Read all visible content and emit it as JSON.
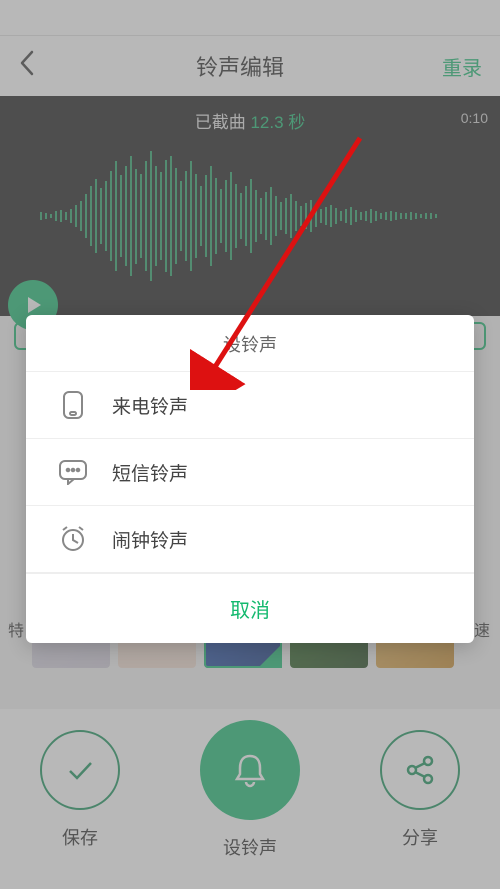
{
  "header": {
    "title": "铃声编辑",
    "rerecord": "重录"
  },
  "waveform": {
    "trimmed_prefix": "已截曲 ",
    "trimmed_value": "12.3 秒",
    "total_time": "0:10"
  },
  "thumbs": {
    "left_tag": "特",
    "right_tag": "快速"
  },
  "actions": {
    "save": "保存",
    "set": "设铃声",
    "share": "分享"
  },
  "dialog": {
    "title": "设铃声",
    "items": [
      {
        "label": "来电铃声"
      },
      {
        "label": "短信铃声"
      },
      {
        "label": "闹钟铃声"
      }
    ],
    "cancel": "取消"
  }
}
